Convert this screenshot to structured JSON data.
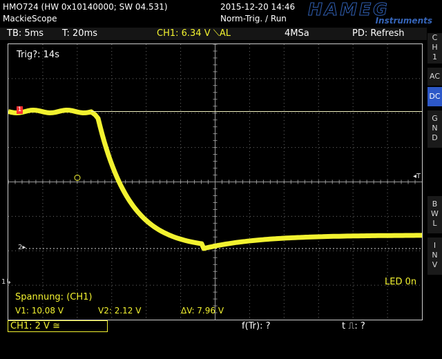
{
  "header": {
    "device": "HMO724 (HW 0x10140000; SW 04.531)",
    "name": "MackieScope",
    "datetime": "2015-12-20 14:46",
    "trigger_state": "Norm-Trig. / Run",
    "logo_main": "HAMEG",
    "logo_sub": "Instruments"
  },
  "status": {
    "timebase": "TB: 5ms",
    "trigger_time": "T: 20ms",
    "channel_level": "CH1: 6.34 V ⟍AL",
    "sample_rate": "4MSa",
    "mode": "PD: Refresh"
  },
  "screen": {
    "trig_label": "Trig?: 14s",
    "marker_ch": "1",
    "marker_cursor": "2",
    "marker_trigger": "T",
    "led_label": "LED  0n"
  },
  "measurement": {
    "title": "Spannung: (CH1)",
    "v1": "V1: 10.08 V",
    "v2": "V2: 2.12 V",
    "dv": "ΔV: 7.96 V"
  },
  "bottom": {
    "ch1": "CH1: 2 V ≅",
    "ftr": "f(Tr): ?",
    "tpulse": "t ⎍: ?"
  },
  "sidebar": {
    "ch_letters": [
      "C",
      "H",
      "1"
    ],
    "ac": "AC",
    "dc": "DC",
    "gnd": [
      "G",
      "N",
      "D"
    ],
    "bwl": [
      "B",
      "W",
      "L"
    ],
    "inv": [
      "I",
      "N",
      "V"
    ]
  },
  "colors": {
    "trace": "#f2f230",
    "grid": "#6e6e6e",
    "accent_blue": "#2d58c8",
    "marker_red": "#ff3030"
  },
  "waveform": {
    "volts_per_div": 2,
    "time_per_div_ms": 5,
    "high_level_V": 10.08,
    "low_level_V": 2.12,
    "settle_level_V": 2.9
  }
}
